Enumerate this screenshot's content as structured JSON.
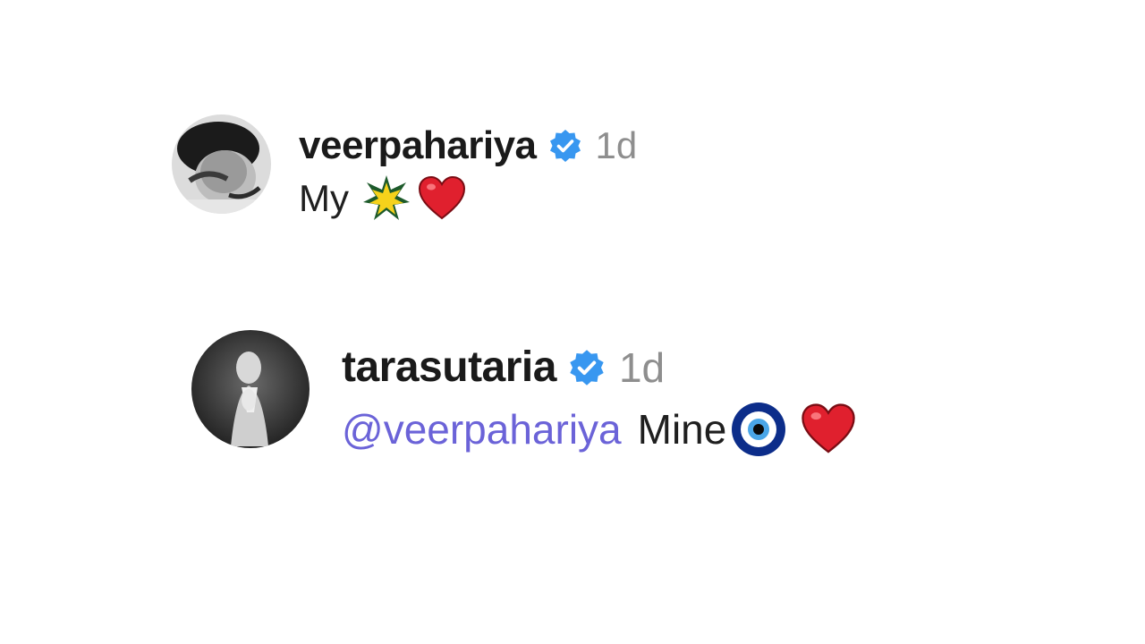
{
  "comments": [
    {
      "username": "veerpahariya",
      "verified": true,
      "timestamp": "1d",
      "text": "My",
      "emojis": [
        "star-burst-emoji",
        "red-heart-emoji"
      ]
    },
    {
      "username": "tarasutaria",
      "verified": true,
      "timestamp": "1d",
      "mention": "@veerpahariya",
      "text": "Mine",
      "emojis": [
        "nazar-amulet-emoji",
        "red-heart-emoji"
      ]
    }
  ],
  "colors": {
    "verified_badge": "#3897f0",
    "mention": "#6b63d8",
    "timestamp": "#8e8e8e",
    "heart": "#e0202e"
  }
}
